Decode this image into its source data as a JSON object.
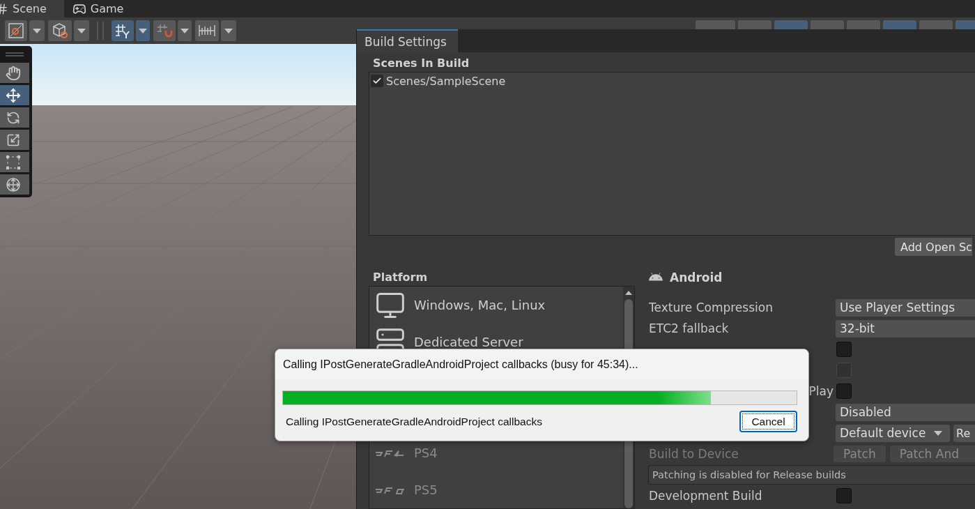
{
  "editor_tabs": [
    {
      "label": "Scene",
      "selected": true
    },
    {
      "label": "Game",
      "selected": false
    }
  ],
  "scene_toolbar": [
    {
      "on": false
    },
    {
      "on": false
    },
    {
      "on": true
    },
    {
      "on": false
    },
    {
      "on": false
    }
  ],
  "view_options": [
    {
      "on": false
    },
    {
      "on": false
    },
    {
      "on": true
    },
    {
      "on": false
    },
    {
      "on": false
    },
    {
      "on": true
    },
    {
      "on": false
    },
    {
      "on": true
    }
  ],
  "tool_palette": [
    {
      "selected": false
    },
    {
      "selected": true
    },
    {
      "selected": false
    },
    {
      "selected": false
    },
    {
      "selected": false
    },
    {
      "selected": false
    }
  ],
  "build_settings": {
    "title": "Build Settings",
    "scenes_heading": "Scenes In Build",
    "scenes": [
      {
        "path": "Scenes/SampleScene",
        "checked": true
      }
    ],
    "add_open_scenes_button": "Add Open Sc",
    "platform_heading": "Platform",
    "platforms": [
      {
        "name": "Windows, Mac, Linux",
        "selected": false,
        "disabled": false
      },
      {
        "name": "Dedicated Server",
        "selected": false,
        "disabled": false
      },
      {
        "name": "PS4",
        "selected": false,
        "disabled": true
      },
      {
        "name": "PS5",
        "selected": false,
        "disabled": true
      }
    ],
    "platform_title": "Android",
    "settings": [
      {
        "kind": "dropdown",
        "label": "Texture Compression",
        "value": "Use Player Settings"
      },
      {
        "kind": "dropdown",
        "label": "ETC2 fallback",
        "value": "32-bit"
      },
      {
        "kind": "checkbox",
        "checked": false,
        "disabled": false
      },
      {
        "kind": "checkbox",
        "checked": false,
        "disabled": true
      },
      {
        "kind": "tail_checkbox",
        "label": "Play",
        "checked": false,
        "disabled": false
      },
      {
        "kind": "dropdown",
        "value": "Disabled"
      },
      {
        "kind": "device",
        "value": "Default device",
        "button": "Re"
      },
      {
        "kind": "buttons",
        "label": "Build to Device",
        "disabled": true,
        "buttons": [
          "Patch",
          "Patch And"
        ]
      },
      {
        "kind": "info",
        "text": "Patching is disabled for Release builds"
      },
      {
        "kind": "checkbox",
        "label": "Development Build",
        "checked": false,
        "disabled": false
      }
    ]
  },
  "progress_dialog": {
    "title": "Calling IPostGenerateGradleAndroidProject callbacks (busy for 45:34)...",
    "level": 0.833,
    "status": "Calling IPostGenerateGradleAndroidProject callbacks",
    "cancel_button": "Cancel"
  }
}
